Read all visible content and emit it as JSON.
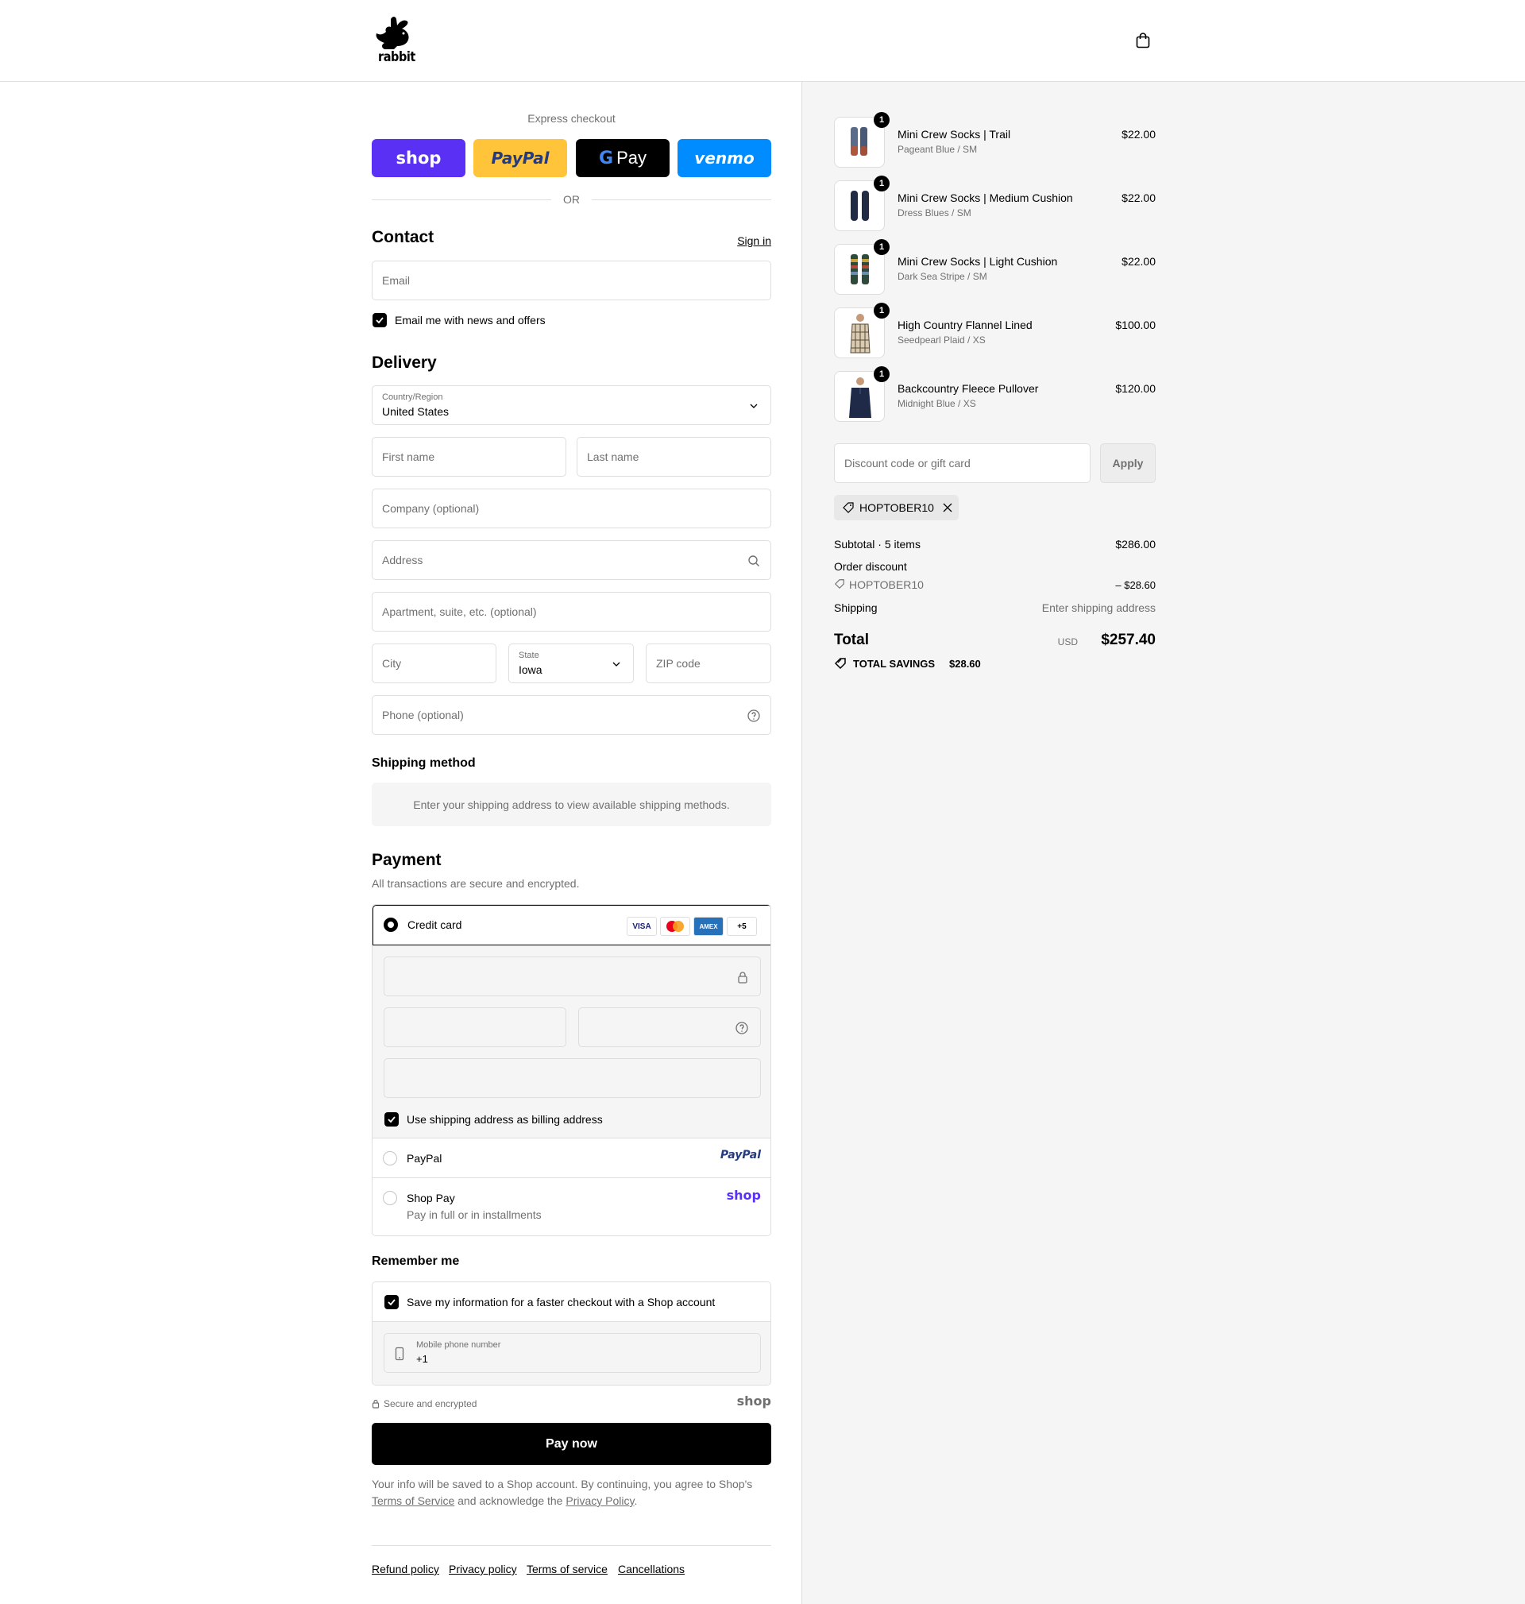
{
  "header": {
    "logo_text": "rabbit"
  },
  "express": {
    "label": "Express checkout",
    "buttons": [
      "shop",
      "PayPal",
      "Pay",
      "venmo"
    ],
    "or_label": "OR"
  },
  "contact": {
    "title": "Contact",
    "sign_in": "Sign in",
    "email_placeholder": "Email",
    "news_label": "Email me with news and offers"
  },
  "delivery": {
    "title": "Delivery",
    "country_label": "Country/Region",
    "country_value": "United States",
    "first_name": "First name",
    "last_name": "Last name",
    "company": "Company (optional)",
    "address": "Address",
    "apartment": "Apartment, suite, etc. (optional)",
    "city": "City",
    "state_label": "State",
    "state_value": "Iowa",
    "zip": "ZIP code",
    "phone": "Phone (optional)"
  },
  "shipping": {
    "title": "Shipping method",
    "message": "Enter your shipping address to view available shipping methods."
  },
  "payment": {
    "title": "Payment",
    "subtitle": "All transactions are secure and encrypted.",
    "credit_card": "Credit card",
    "card_logos": [
      "VISA",
      "",
      "AMEX",
      "+5"
    ],
    "billing_label": "Use shipping address as billing address",
    "paypal_label": "PayPal",
    "paypal_logo": "PayPal",
    "shoppay_label": "Shop Pay",
    "shoppay_sub": "Pay in full or in installments",
    "shoppay_logo": "shop"
  },
  "remember": {
    "title": "Remember me",
    "save_label": "Save my information for a faster checkout with a Shop account",
    "mobile_label": "Mobile phone number",
    "mobile_value": "+1",
    "secure": "Secure and encrypted",
    "shop_logo": "shop"
  },
  "pay_now": "Pay now",
  "legal": {
    "text1": "Your info will be saved to a Shop account. By continuing, you agree to Shop's",
    "terms": "Terms of Service",
    "text2": "and acknowledge the",
    "privacy": "Privacy Policy",
    "period": "."
  },
  "footer_links": [
    "Refund policy",
    "Privacy policy",
    "Terms of service",
    "Cancellations"
  ],
  "cart": {
    "items": [
      {
        "name": "Mini Crew Socks | Trail",
        "variant": "Pageant Blue / SM",
        "price": "$22.00",
        "qty": "1"
      },
      {
        "name": "Mini Crew Socks | Medium Cushion",
        "variant": "Dress Blues / SM",
        "price": "$22.00",
        "qty": "1"
      },
      {
        "name": "Mini Crew Socks | Light Cushion",
        "variant": "Dark Sea Stripe / SM",
        "price": "$22.00",
        "qty": "1"
      },
      {
        "name": "High Country Flannel Lined",
        "variant": "Seedpearl Plaid / XS",
        "price": "$100.00",
        "qty": "1"
      },
      {
        "name": "Backcountry Fleece Pullover",
        "variant": "Midnight Blue / XS",
        "price": "$120.00",
        "qty": "1"
      }
    ],
    "discount_placeholder": "Discount code or gift card",
    "apply": "Apply",
    "code_chip": "HOPTOBER10",
    "subtotal_label": "Subtotal · 5 items",
    "subtotal_value": "$286.00",
    "order_discount_label": "Order discount",
    "discount_code": "HOPTOBER10",
    "discount_value": "– $28.60",
    "shipping_label": "Shipping",
    "shipping_value": "Enter shipping address",
    "total_label": "Total",
    "currency": "USD",
    "total_value": "$257.40",
    "savings_label": "TOTAL SAVINGS",
    "savings_value": "$28.60"
  },
  "colors": {
    "shop_purple": "#5a31f4",
    "paypal_yellow": "#ffc439",
    "venmo_blue": "#008cff",
    "border": "#dedede",
    "muted": "#707070"
  }
}
